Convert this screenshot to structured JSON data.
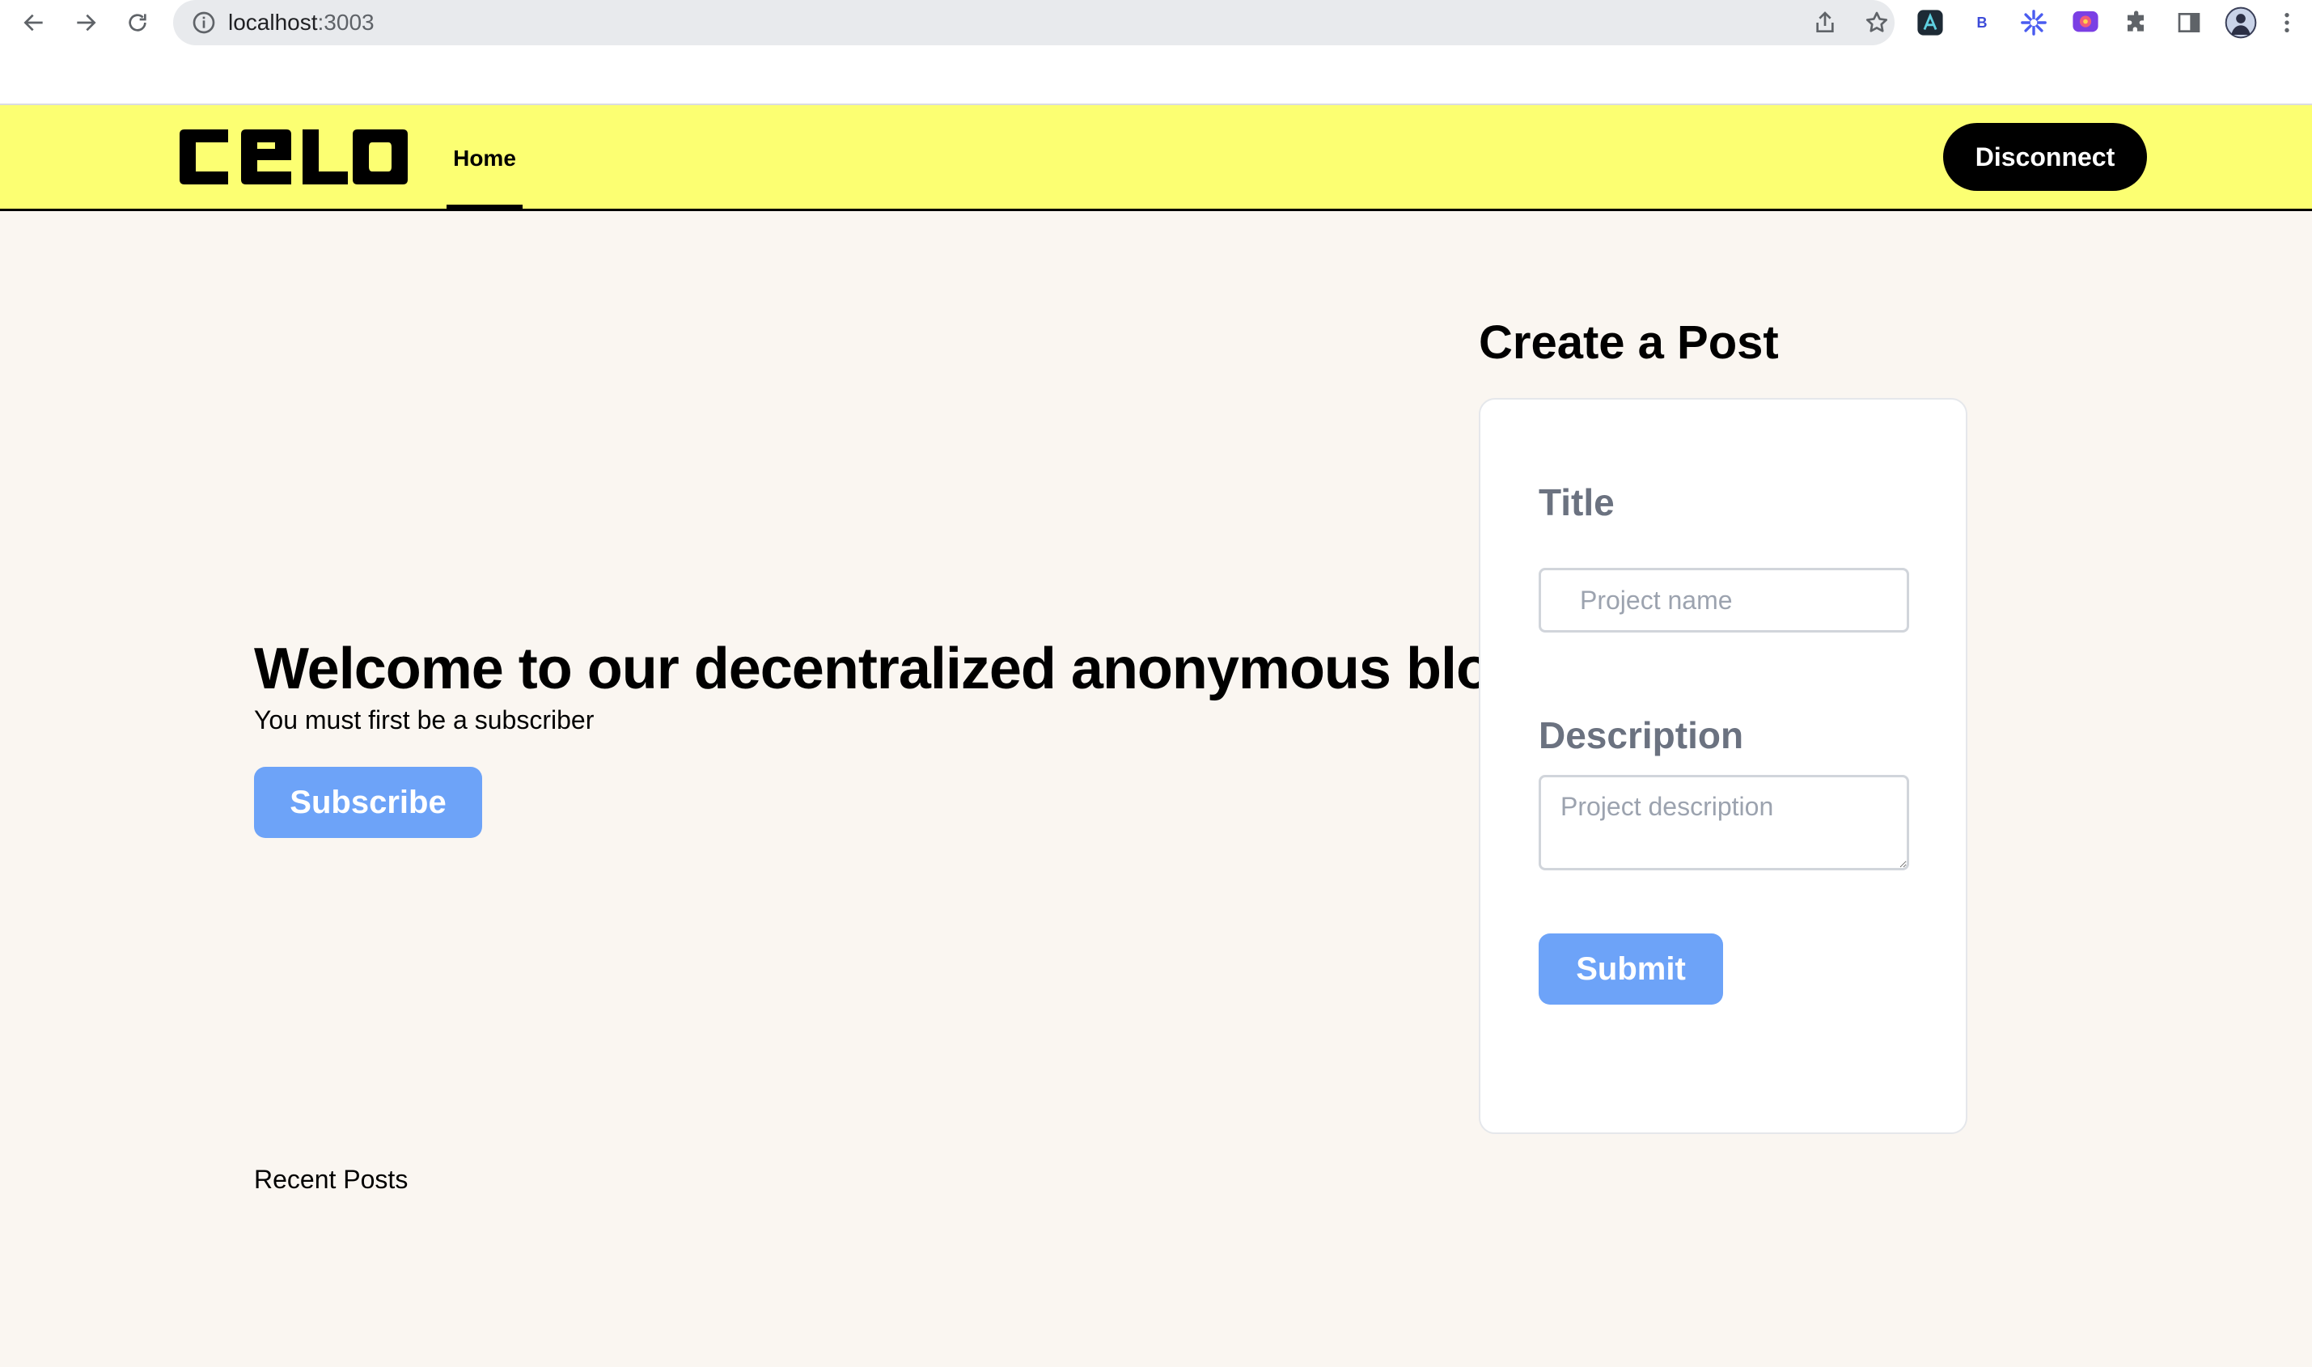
{
  "browser": {
    "url_host": "localhost",
    "url_port": ":3003",
    "icons": {
      "back": "arrow-left-icon",
      "forward": "arrow-right-icon",
      "reload": "reload-icon",
      "site_info": "info-icon",
      "share": "share-icon",
      "bookmark": "star-icon",
      "extensions": [
        "extension-a-icon",
        "extension-b-icon",
        "extension-burst-icon",
        "extension-chat-icon",
        "puzzle-icon",
        "side-panel-icon",
        "profile-avatar-icon",
        "more-vert-icon"
      ]
    },
    "extension_b_label": "B"
  },
  "header": {
    "logo_text": "CELO",
    "nav_home": "Home",
    "disconnect_label": "Disconnect",
    "background": "#fcff72"
  },
  "hero": {
    "title": "Welcome to our decentralized anonymous blog",
    "subtitle": "You must first be a subscriber",
    "subscribe_label": "Subscribe"
  },
  "posts": {
    "heading": "Recent Posts"
  },
  "create_post": {
    "heading": "Create a Post",
    "title_label": "Title",
    "title_placeholder": "Project name",
    "title_value": "",
    "description_label": "Description",
    "description_placeholder": "Project description",
    "description_value": "",
    "submit_label": "Submit"
  },
  "colors": {
    "accent_button": "#6da3f8",
    "page_background": "#faf6f1",
    "header_yellow": "#fcff72"
  }
}
